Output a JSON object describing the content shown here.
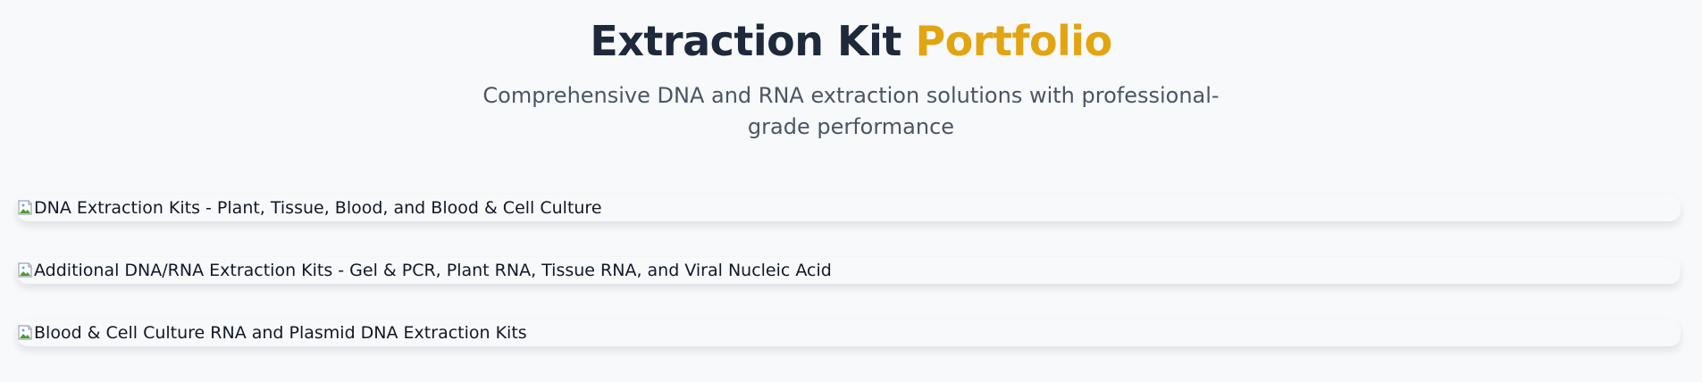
{
  "header": {
    "title_main": "Extraction Kit",
    "title_accent": "Portfolio",
    "subtitle": "Comprehensive DNA and RNA extraction solutions with professional-grade performance"
  },
  "kits": [
    {
      "alt": "DNA Extraction Kits - Plant, Tissue, Blood, and Blood & Cell Culture"
    },
    {
      "alt": "Additional DNA/RNA Extraction Kits - Gel & PCR, Plant RNA, Tissue RNA, and Viral Nucleic Acid"
    },
    {
      "alt": "Blood & Cell Culture RNA and Plasmid DNA Extraction Kits"
    }
  ],
  "colors": {
    "background": "#f8f9fb",
    "title": "#1e293b",
    "accent": "#e2a511",
    "subtitle": "#4b5563"
  },
  "icons": {
    "broken_image": "broken-image-icon"
  }
}
